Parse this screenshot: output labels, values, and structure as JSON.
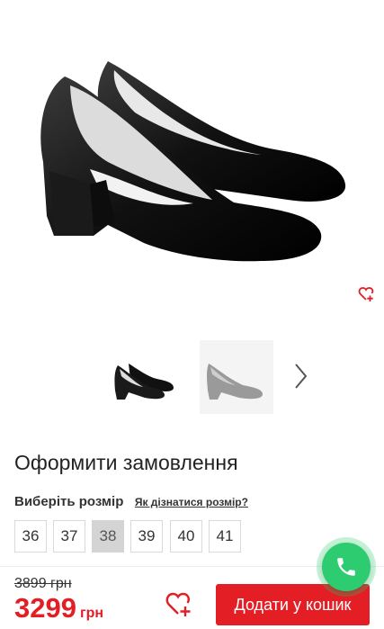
{
  "product": {
    "title": "Оформити замовлення"
  },
  "gallery": {
    "thumbnails": [
      "black-shoe-thumbnail",
      "grey-shoe-thumbnail"
    ]
  },
  "size_picker": {
    "label": "Виберіть розмір",
    "help_link": "Як дізнатися розмір?",
    "options": [
      "36",
      "37",
      "38",
      "39",
      "40",
      "41"
    ],
    "selected": "38"
  },
  "price": {
    "old": "3899 грн",
    "amount": "3299",
    "currency": "грн"
  },
  "actions": {
    "add_to_cart": "Додати у кошик",
    "wishlist_icon": "heart-plus-icon",
    "call_icon": "phone-icon"
  },
  "colors": {
    "accent": "#e31e24",
    "call": "#2ecc71",
    "selected_size_bg": "#d4d4d4"
  }
}
